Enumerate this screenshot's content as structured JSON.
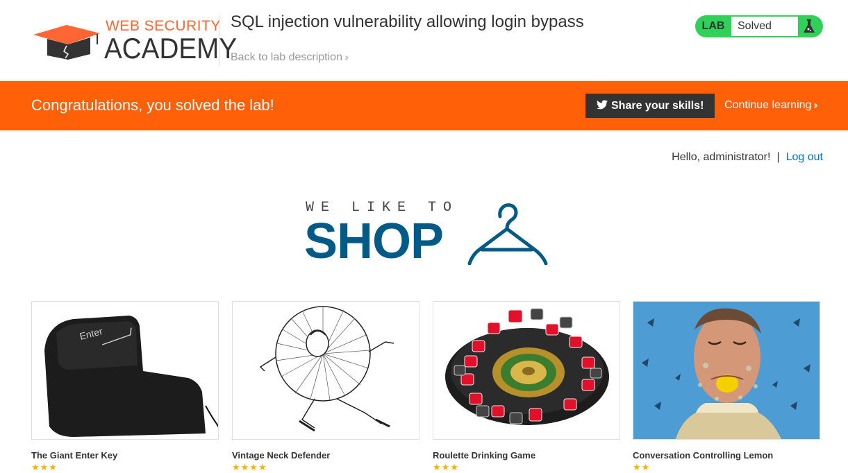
{
  "header": {
    "logo": {
      "line1": "WEB SECURITY",
      "line2": "ACADEMY"
    },
    "lab_title": "SQL injection vulnerability allowing login bypass",
    "back_link": "Back to lab description",
    "lab_badge": {
      "label": "LAB",
      "status": "Solved"
    }
  },
  "banner": {
    "message": "Congratulations, you solved the lab!",
    "share_button": "Share your skills!",
    "continue_link": "Continue learning"
  },
  "account": {
    "greeting": "Hello, administrator!",
    "separator": "|",
    "logout": "Log out"
  },
  "shop_logo": {
    "tagline": "WE LIKE TO",
    "word": "SHOP"
  },
  "products": [
    {
      "name": "The Giant Enter Key",
      "key_label": "Enter"
    },
    {
      "name": "Vintage Neck Defender"
    },
    {
      "name": "Roulette Drinking Game"
    },
    {
      "name": "Conversation Controlling Lemon"
    }
  ],
  "colors": {
    "brand_orange": "#ff6008",
    "solved_green": "#30d158",
    "link_blue": "#0071bc",
    "shop_blue": "#005a87"
  }
}
